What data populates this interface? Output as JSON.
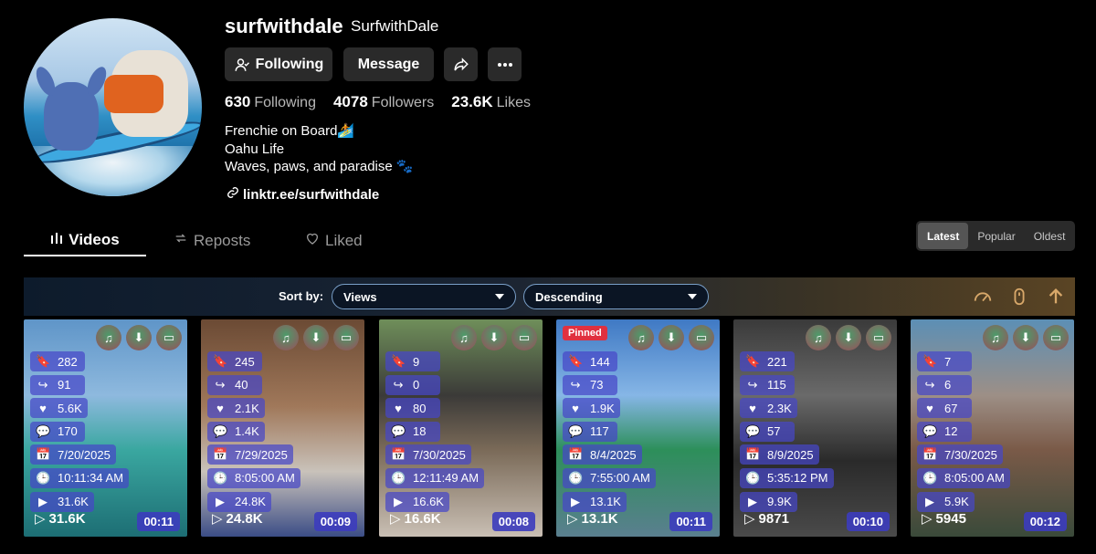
{
  "profile": {
    "username": "surfwithdale",
    "nickname": "SurfwithDale",
    "following_btn": "Following",
    "message_btn": "Message",
    "stats": {
      "following_count": "630",
      "following_label": "Following",
      "followers_count": "4078",
      "followers_label": "Followers",
      "likes_count": "23.6K",
      "likes_label": "Likes"
    },
    "bio": [
      "Frenchie on Board🏄",
      "Oahu Life",
      "Waves, paws, and paradise 🐾"
    ],
    "link": "linktr.ee/surfwithdale"
  },
  "tabs": {
    "videos": "Videos",
    "reposts": "Reposts",
    "liked": "Liked"
  },
  "sort_segment": {
    "latest": "Latest",
    "popular": "Popular",
    "oldest": "Oldest",
    "selected": "Latest"
  },
  "sortbar": {
    "label": "Sort by:",
    "field": "Views",
    "order": "Descending"
  },
  "videos": [
    {
      "saves": "282",
      "shares": "91",
      "likes": "5.6K",
      "comments": "170",
      "date": "7/20/2025",
      "time": "10:11:34 AM",
      "views": "31.6K",
      "views_overlay": "31.6K",
      "duration": "00:11",
      "pinned": ""
    },
    {
      "saves": "245",
      "shares": "40",
      "likes": "2.1K",
      "comments": "1.4K",
      "date": "7/29/2025",
      "time": "8:05:00 AM",
      "views": "24.8K",
      "views_overlay": "24.8K",
      "duration": "00:09",
      "pinned": ""
    },
    {
      "saves": "9",
      "shares": "0",
      "likes": "80",
      "comments": "18",
      "date": "7/30/2025",
      "time": "12:11:49 AM",
      "views": "16.6K",
      "views_overlay": "16.6K",
      "duration": "00:08",
      "pinned": ""
    },
    {
      "saves": "144",
      "shares": "73",
      "likes": "1.9K",
      "comments": "117",
      "date": "8/4/2025",
      "time": "7:55:00 AM",
      "views": "13.1K",
      "views_overlay": "13.1K",
      "duration": "00:11",
      "pinned": "Pinned"
    },
    {
      "saves": "221",
      "shares": "115",
      "likes": "2.3K",
      "comments": "57",
      "date": "8/9/2025",
      "time": "5:35:12 PM",
      "views": "9.9K",
      "views_overlay": "9871",
      "duration": "00:10",
      "pinned": ""
    },
    {
      "saves": "7",
      "shares": "6",
      "likes": "67",
      "comments": "12",
      "date": "7/30/2025",
      "time": "8:05:00 AM",
      "views": "5.9K",
      "views_overlay": "5945",
      "duration": "00:12",
      "pinned": ""
    }
  ]
}
